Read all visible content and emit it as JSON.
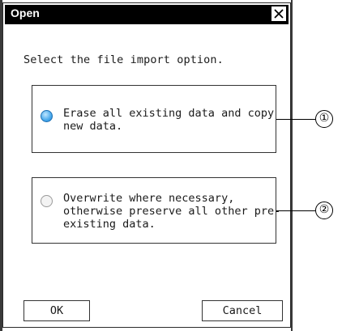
{
  "dialog": {
    "title": "Open",
    "close_icon": "close-icon",
    "prompt": "Select the file import option."
  },
  "options": [
    {
      "label": "Erase all existing data and copy\nnew data.",
      "selected": true
    },
    {
      "label": "Overwrite where necessary,\notherwise preserve all other pre-\nexisting data.",
      "selected": false
    }
  ],
  "callouts": [
    "①",
    "②"
  ],
  "buttons": {
    "ok": "OK",
    "cancel": "Cancel"
  },
  "colors": {
    "titlebar": "#000000",
    "radio_selected": "#49a9ec"
  }
}
